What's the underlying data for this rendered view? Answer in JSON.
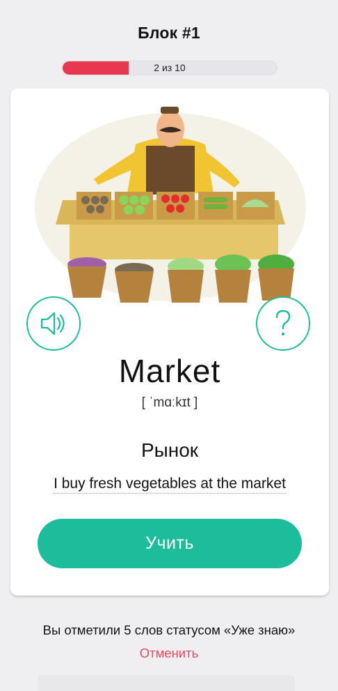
{
  "header": {
    "title": "Блок #1"
  },
  "progress": {
    "text": "2 из 10",
    "current": 2,
    "total": 10,
    "fill_color": "#e8384f"
  },
  "card": {
    "word": "Market",
    "transcription": "[ ˈmɑːkɪt ]",
    "translation": "Рынок",
    "example": "I buy fresh vegetables at the market",
    "learn_button": "Учить",
    "icons": {
      "sound": "speaker-icon",
      "help": "question-icon"
    },
    "accent_color": "#1dbd9b"
  },
  "footer": {
    "notice": "Вы отметили 5 слов статусом «Уже знаю»",
    "undo": "Отменить",
    "undo_color": "#e8485e"
  }
}
